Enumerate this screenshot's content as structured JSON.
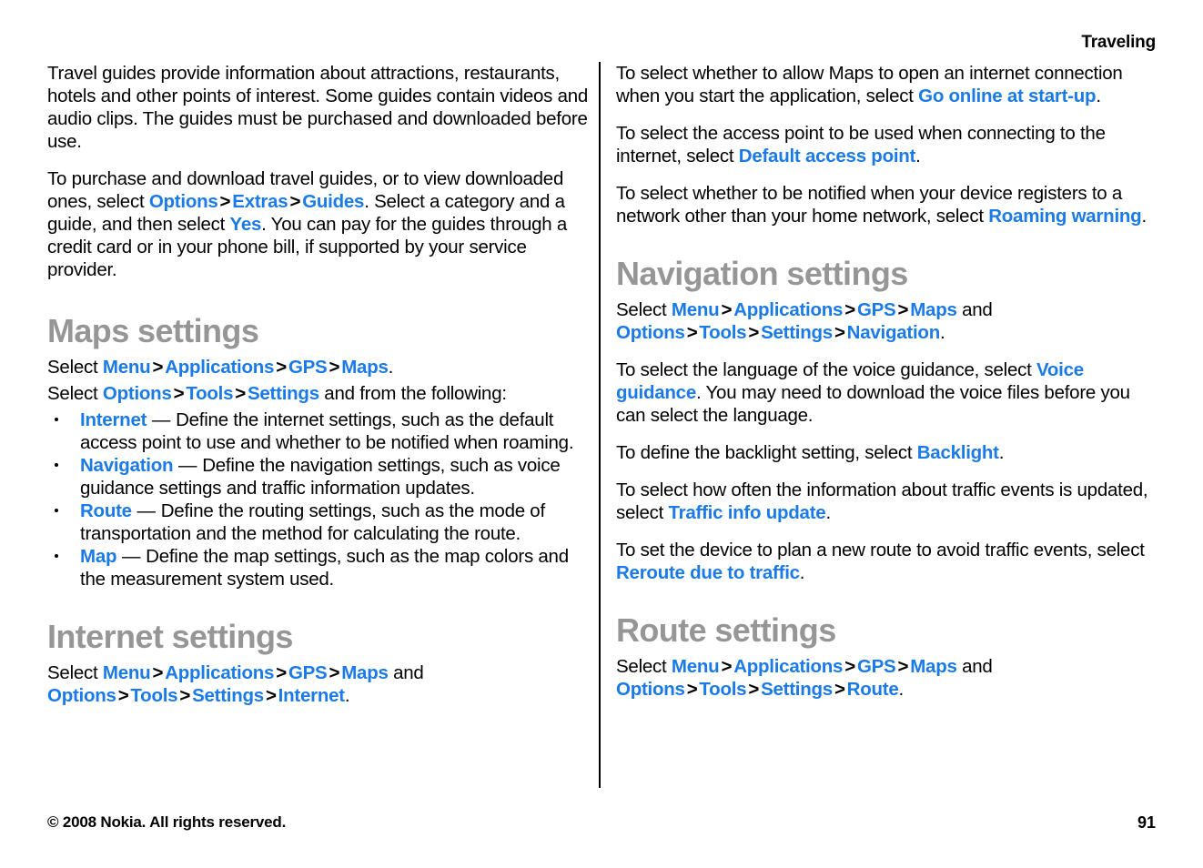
{
  "header": {
    "running_title": "Traveling"
  },
  "footer": {
    "copyright": "© 2008 Nokia. All rights reserved.",
    "page_number": "91"
  },
  "colors": {
    "link": "#1a7ae8",
    "heading": "#969696",
    "body": "#000000"
  },
  "left_column": {
    "p1": "Travel guides provide information about attractions, restaurants, hotels and other points of interest. Some guides contain videos and audio clips. The guides must be purchased and downloaded before use.",
    "p2_a": "To purchase and download travel guides, or to view downloaded ones, select ",
    "p2_link1": "Options",
    "p2_sep1": ">",
    "p2_link2": "Extras",
    "p2_sep2": ">",
    "p2_link3": "Guides",
    "p2_b": ". Select a category and a guide, and then select ",
    "p2_link4": "Yes",
    "p2_c": ". You can pay for the guides through a credit card or in your phone bill, if supported by your service provider.",
    "maps_settings": {
      "heading": "Maps settings",
      "path1_prefix": "Select ",
      "path1_link1": "Menu",
      "path1_sep1": ">",
      "path1_link2": "Applications",
      "path1_sep2": ">",
      "path1_link3": "GPS",
      "path1_sep3": ">",
      "path1_link4": "Maps",
      "path1_suffix": ".",
      "path2_prefix": "Select ",
      "path2_link1": "Options",
      "path2_sep1": ">",
      "path2_link2": "Tools",
      "path2_sep2": ">",
      "path2_link3": "Settings",
      "path2_suffix": " and from the following:",
      "bullets": [
        {
          "term": "Internet",
          "dash": " — ",
          "text": "Define the internet settings, such as the default access point to use and whether to be notified when roaming."
        },
        {
          "term": "Navigation",
          "dash": " — ",
          "text": "Define the navigation settings, such as voice guidance settings and traffic information updates."
        },
        {
          "term": "Route",
          "dash": " — ",
          "text": "Define the routing settings, such as the mode of transportation and the method for calculating the route."
        },
        {
          "term": "Map",
          "dash": " — ",
          "text": "Define the map settings, such as the map colors and the measurement system used."
        }
      ]
    },
    "internet_settings": {
      "heading": "Internet settings",
      "path_prefix": "Select ",
      "path_link1": "Menu",
      "path_sep1": ">",
      "path_link2": "Applications",
      "path_sep2": ">",
      "path_link3": "GPS",
      "path_sep3": ">",
      "path_link4": "Maps",
      "path_and": " and ",
      "path_link5": "Options",
      "path_sep4": ">",
      "path_link6": "Tools",
      "path_sep5": ">",
      "path_link7": "Settings",
      "path_sep6": ">",
      "path_link8": "Internet",
      "path_suffix": "."
    }
  },
  "right_column": {
    "p1_a": "To select whether to allow Maps to open an internet connection when you start the application, select ",
    "p1_link": "Go online at start-up",
    "p1_b": ".",
    "p2_a": "To select the access point to be used when connecting to the internet, select ",
    "p2_link": "Default access point",
    "p2_b": ".",
    "p3_a": "To select whether to be notified when your device registers to a network other than your home network, select ",
    "p3_link": "Roaming warning",
    "p3_b": ".",
    "navigation_settings": {
      "heading": "Navigation settings",
      "path_prefix": "Select ",
      "path_link1": "Menu",
      "path_sep1": ">",
      "path_link2": "Applications",
      "path_sep2": ">",
      "path_link3": "GPS",
      "path_sep3": ">",
      "path_link4": "Maps",
      "path_and": " and ",
      "path_link5": "Options",
      "path_sep4": ">",
      "path_link6": "Tools",
      "path_sep5": ">",
      "path_link7": "Settings",
      "path_sep6": ">",
      "path_link8": "Navigation",
      "path_suffix": ".",
      "p_voice_a": "To select the language of the voice guidance, select ",
      "p_voice_link": "Voice guidance",
      "p_voice_b": ". You may need to download the voice files before you can select the language.",
      "p_backlight_a": "To define the backlight setting, select ",
      "p_backlight_link": "Backlight",
      "p_backlight_b": ".",
      "p_traffic_a": "To select how often the information about traffic events is updated, select ",
      "p_traffic_link": "Traffic info update",
      "p_traffic_b": ".",
      "p_reroute_a": "To set the device to plan a new route to avoid traffic events, select ",
      "p_reroute_link": "Reroute due to traffic",
      "p_reroute_b": "."
    },
    "route_settings": {
      "heading": "Route settings",
      "path_prefix": "Select ",
      "path_link1": "Menu",
      "path_sep1": ">",
      "path_link2": "Applications",
      "path_sep2": ">",
      "path_link3": "GPS",
      "path_sep3": ">",
      "path_link4": "Maps",
      "path_and": " and ",
      "path_link5": "Options",
      "path_sep4": ">",
      "path_link6": "Tools",
      "path_sep5": ">",
      "path_link7": "Settings",
      "path_sep6": ">",
      "path_link8": "Route",
      "path_suffix": "."
    }
  }
}
